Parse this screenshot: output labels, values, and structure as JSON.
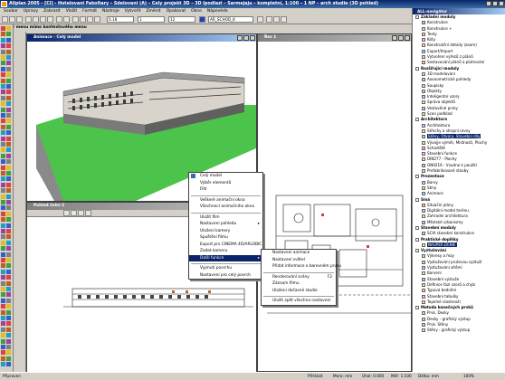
{
  "app": {
    "title": "Allplan 2005 - [Cl] - Hotelovani Fakoltary – Sdelovani (A) – Cely projekt 3D – 3D Ipodlazi – Sarmejaju – kompletní, 1:100 – 1 NP – arch studie (3D pohled)"
  },
  "menubar": [
    "Soubor",
    "Upravy",
    "Zobrazit",
    "Vložit",
    "Formát",
    "Nástroje",
    "Vytvořit",
    "Změnit",
    "Opakovat",
    "Okno",
    "Nápověda"
  ],
  "toolbar": {
    "pen_value": "0.18",
    "line_value": "1",
    "color_value": "12",
    "layer_value": "AR_SCHOD_K"
  },
  "left_panel_title": "Výběr menu mimo kontextového menu",
  "windows": {
    "animation": {
      "title": "Animace - Celý model"
    },
    "section": {
      "title": "Řez 1"
    },
    "elevation": {
      "title": "Pohled čelní 2"
    }
  },
  "context_menu": {
    "items": [
      {
        "label": "Celý model",
        "type": "checked"
      },
      {
        "label": "Výběr elementů",
        "type": "normal"
      },
      {
        "label": "Filtr",
        "type": "normal"
      },
      {
        "type": "sep"
      },
      {
        "label": "Veškeré animační okna",
        "type": "normal"
      },
      {
        "label": "Všechnecl animačního okna",
        "type": "normal"
      },
      {
        "type": "sep"
      },
      {
        "label": "Uložit film",
        "type": "normal"
      },
      {
        "label": "Nastavení pohledu",
        "type": "submenu"
      },
      {
        "label": "Uložení kamery",
        "type": "normal"
      },
      {
        "label": "Spuštění filmu",
        "type": "normal"
      },
      {
        "label": "Export pro CINEMA 4D/ARLOBIC",
        "type": "normal"
      },
      {
        "label": "Zadat kameru",
        "type": "normal"
      },
      {
        "label": "Další funkce",
        "type": "submenu",
        "selected": true
      },
      {
        "type": "sep"
      },
      {
        "label": "Vyjmutí povrchu",
        "type": "normal"
      },
      {
        "label": "Nastavení pro celý povrch",
        "type": "normal"
      }
    ]
  },
  "submenu": {
    "items": [
      {
        "label": "Nastavení animace",
        "shortcut": ""
      },
      {
        "label": "Nastavení světel",
        "shortcut": ""
      },
      {
        "label": "Přidat informace o barevném prvku",
        "shortcut": ""
      },
      {
        "type": "sep"
      },
      {
        "label": "Renderování scény",
        "shortcut": "F2"
      },
      {
        "label": "Záznam filmu",
        "shortcut": ""
      },
      {
        "label": "Uložení dočasné studie",
        "shortcut": ""
      },
      {
        "type": "sep"
      },
      {
        "label": "Uložit zpět všechna nastavení",
        "shortcut": ""
      }
    ]
  },
  "navigator": {
    "title": "ALL-navigátor",
    "rows": [
      {
        "label": "Základní moduly",
        "level": 0,
        "group": true
      },
      {
        "label": "Konstrukce",
        "level": 1
      },
      {
        "label": "Konstrukce +",
        "level": 1
      },
      {
        "label": "Texty",
        "level": 1
      },
      {
        "label": "Kóty",
        "level": 1
      },
      {
        "label": "Konstrukční detaily (zoom)",
        "level": 1
      },
      {
        "label": "Export/Import",
        "level": 1
      },
      {
        "label": "Vytvoření výřezů z plánů",
        "level": 1
      },
      {
        "label": "Sestavování plánů a plotrování",
        "level": 1
      },
      {
        "label": "Rozšiřující moduly",
        "level": 0,
        "group": true
      },
      {
        "label": "3D modelování",
        "level": 1
      },
      {
        "label": "Axonometrické pohledy",
        "level": 1
      },
      {
        "label": "Soupisky",
        "level": 1
      },
      {
        "label": "Objekty",
        "level": 1
      },
      {
        "label": "Inteligentní vzory",
        "level": 1
      },
      {
        "label": "Správa objektů",
        "level": 1
      },
      {
        "label": "Vestavěné prvky",
        "level": 1
      },
      {
        "label": "Scan podklad",
        "level": 1
      },
      {
        "label": "Architektura",
        "level": 0,
        "group": true
      },
      {
        "label": "Architektura",
        "level": 1
      },
      {
        "label": "Střechy a stropní rovny",
        "level": 1
      },
      {
        "label": "Stěny, Otvory, Stavební díly",
        "level": 1,
        "selected": true
      },
      {
        "label": "Vývojje výměr, Místnosti, Plochy",
        "level": 1
      },
      {
        "label": "Schodiště",
        "level": 1
      },
      {
        "label": "Stavební funkce",
        "level": 1
      },
      {
        "label": "DIN277 - Plochy",
        "level": 1
      },
      {
        "label": "ON9216 - Vvodne k použití",
        "level": 1
      },
      {
        "label": "Prefabrikované stavby",
        "level": 1
      },
      {
        "label": "Prezentace",
        "level": 0,
        "group": true
      },
      {
        "label": "Barvy",
        "level": 1
      },
      {
        "label": "Stíny",
        "level": 1
      },
      {
        "label": "Animace",
        "level": 1
      },
      {
        "label": "Síná",
        "level": 0,
        "group": true
      },
      {
        "label": "Situační plány",
        "level": 1
      },
      {
        "label": "Digitální model terénu",
        "level": 1
      },
      {
        "label": "Zahradní architektura",
        "level": 1
      },
      {
        "label": "Městské urbanismy",
        "level": 1
      },
      {
        "label": "Stavební moduly",
        "level": 0,
        "group": true
      },
      {
        "label": "SCIA stavební konstrukce",
        "level": 1
      },
      {
        "label": "Praktické doplňky",
        "level": 0,
        "group": true
      },
      {
        "label": "NAUPER.DENIE",
        "level": 1,
        "selected": true
      },
      {
        "label": "Vyztužování",
        "level": 0,
        "group": true
      },
      {
        "label": "Výkresy a řezy",
        "level": 1
      },
      {
        "label": "Vyztužování prutovou výztuží",
        "level": 1
      },
      {
        "label": "Vyztužování sítěmi",
        "level": 1
      },
      {
        "label": "Barvení",
        "level": 1
      },
      {
        "label": "Stavební výstuže",
        "level": 1
      },
      {
        "label": "Definice fazí vzorů a chyb",
        "level": 1
      },
      {
        "label": "Typová bednění",
        "level": 1
      },
      {
        "label": "Stavební tabulky",
        "level": 1
      },
      {
        "label": "Tepelné vlastnosti",
        "level": 1
      },
      {
        "label": "Metoda konečných prvků",
        "level": 0,
        "group": true
      },
      {
        "label": "Prvk. Desky",
        "level": 1
      },
      {
        "label": "Desky - grafický výstup",
        "level": 1
      },
      {
        "label": "Prvk. Stěny",
        "level": 1
      },
      {
        "label": "Stěny - grafický výstup",
        "level": 1
      }
    ]
  },
  "statusbar": {
    "ready": "Připraven",
    "mode": "Přihlásit",
    "unit": "Mera: mm",
    "angle": "Úhel: 0.000",
    "scale": "Měř: 1:100",
    "length": "Délka: mm",
    "cursor": "100%"
  }
}
